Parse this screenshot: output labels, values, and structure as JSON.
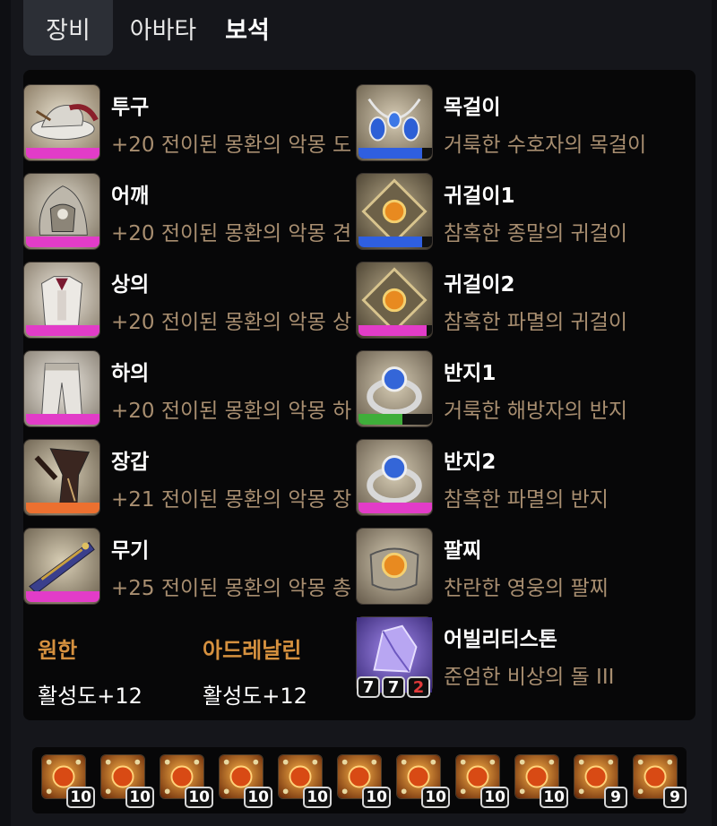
{
  "tabs": [
    {
      "label": "장비"
    },
    {
      "label": "아바타"
    },
    {
      "label": "보석"
    }
  ],
  "equipment": [
    {
      "name": "투구",
      "desc": "+20 전이된 몽환의 악몽 도",
      "quality": 1.0,
      "quality_color": "#e23cc8",
      "icon": "helmet-icon"
    },
    {
      "name": "어깨",
      "desc": "+20 전이된 몽환의 악몽 견",
      "quality": 1.0,
      "quality_color": "#e23cc8",
      "icon": "shoulder-icon"
    },
    {
      "name": "상의",
      "desc": "+20 전이된 몽환의 악몽 상",
      "quality": 1.0,
      "quality_color": "#e23cc8",
      "icon": "chest-armor-icon"
    },
    {
      "name": "하의",
      "desc": "+20 전이된 몽환의 악몽 하",
      "quality": 1.0,
      "quality_color": "#e23cc8",
      "icon": "pants-icon"
    },
    {
      "name": "장갑",
      "desc": "+21 전이된 몽환의 악몽 장",
      "quality": 1.0,
      "quality_color": "#ec7030",
      "icon": "gloves-icon"
    },
    {
      "name": "무기",
      "desc": "+25 전이된 몽환의 악몽 총",
      "quality": 1.0,
      "quality_color": "#e23cc8",
      "icon": "weapon-icon"
    }
  ],
  "accessories": [
    {
      "name": "목걸이",
      "desc": "거룩한 수호자의 목걸이",
      "quality": 0.87,
      "quality_color": "#2f5fe0",
      "icon": "necklace-icon"
    },
    {
      "name": "귀걸이1",
      "desc": "참혹한 종말의 귀걸이",
      "quality": 0.87,
      "quality_color": "#2f5fe0",
      "icon": "earring-icon"
    },
    {
      "name": "귀걸이2",
      "desc": "참혹한 파멸의 귀걸이",
      "quality": 0.93,
      "quality_color": "#e23cc8",
      "icon": "earring-icon"
    },
    {
      "name": "반지1",
      "desc": "거룩한 해방자의 반지",
      "quality": 0.6,
      "quality_color": "#3fae3a",
      "icon": "ring-icon"
    },
    {
      "name": "반지2",
      "desc": "참혹한 파멸의 반지",
      "quality": 1.0,
      "quality_color": "#e23cc8",
      "icon": "ring-icon"
    },
    {
      "name": "팔찌",
      "desc": "찬란한 영웅의 팔찌",
      "icon": "bracelet-icon"
    }
  ],
  "ability_stone": {
    "name": "어빌리티스톤",
    "desc": "준엄한 비상의 돌 III",
    "levels": [
      "7",
      "7",
      "2"
    ],
    "icon": "ability-stone-icon"
  },
  "stats": [
    {
      "title": "원한",
      "value": "활성도+12"
    },
    {
      "title": "아드레날린",
      "value": "활성도+12"
    }
  ],
  "gems": [
    "10",
    "10",
    "10",
    "10",
    "10",
    "10",
    "10",
    "10",
    "10",
    "9",
    "9"
  ],
  "colors": {
    "stat_title": "#d6913f",
    "desc_text": "#a88e70",
    "quality_pink": "#e23cc8",
    "quality_blue": "#2f5fe0",
    "quality_green": "#3fae3a",
    "quality_orange": "#ec7030",
    "badge_red": "#e23a3a"
  }
}
